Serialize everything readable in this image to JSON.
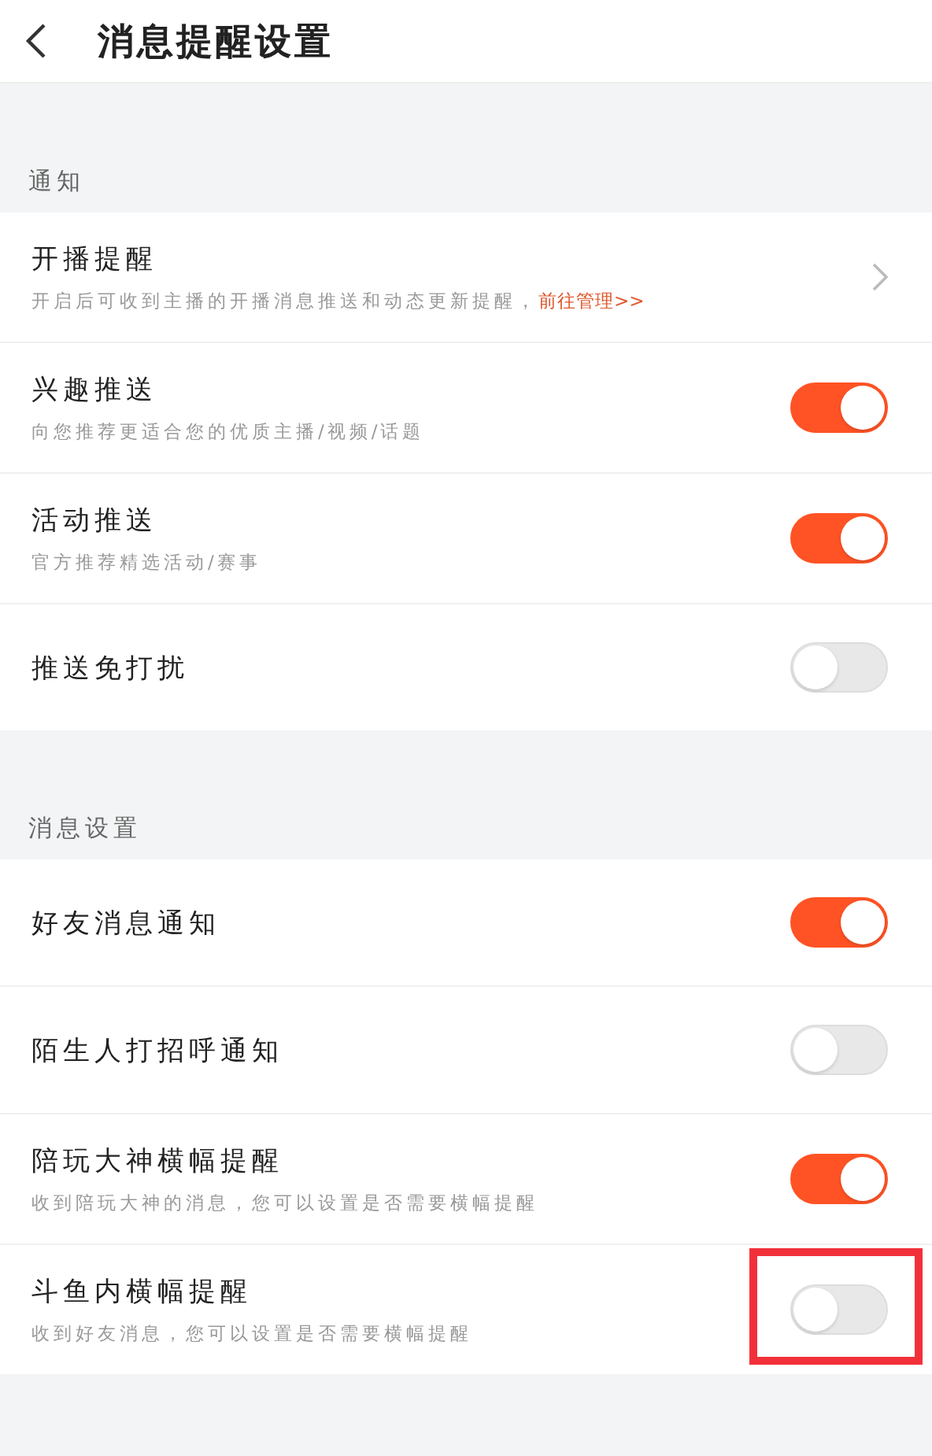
{
  "header": {
    "title": "消息提醒设置"
  },
  "sections": [
    {
      "label": "通知",
      "rows": [
        {
          "kind": "link",
          "title": "开播提醒",
          "subtitle": "开启后可收到主播的开播消息推送和动态更新提醒，",
          "link": "前往管理>>"
        },
        {
          "kind": "toggle",
          "title": "兴趣推送",
          "subtitle": "向您推荐更适合您的优质主播/视频/话题",
          "on": true
        },
        {
          "kind": "toggle",
          "title": "活动推送",
          "subtitle": "官方推荐精选活动/赛事",
          "on": true
        },
        {
          "kind": "toggle",
          "title": "推送免打扰",
          "on": false
        }
      ]
    },
    {
      "label": "消息设置",
      "rows": [
        {
          "kind": "toggle",
          "title": "好友消息通知",
          "on": true
        },
        {
          "kind": "toggle",
          "title": "陌生人打招呼通知",
          "on": false
        },
        {
          "kind": "toggle",
          "title": "陪玩大神横幅提醒",
          "subtitle": "收到陪玩大神的消息，您可以设置是否需要横幅提醒",
          "on": true
        },
        {
          "kind": "toggle",
          "title": "斗鱼内横幅提醒",
          "subtitle": "收到好友消息，您可以设置是否需要横幅提醒",
          "on": false,
          "highlighted": true
        }
      ]
    }
  ]
}
